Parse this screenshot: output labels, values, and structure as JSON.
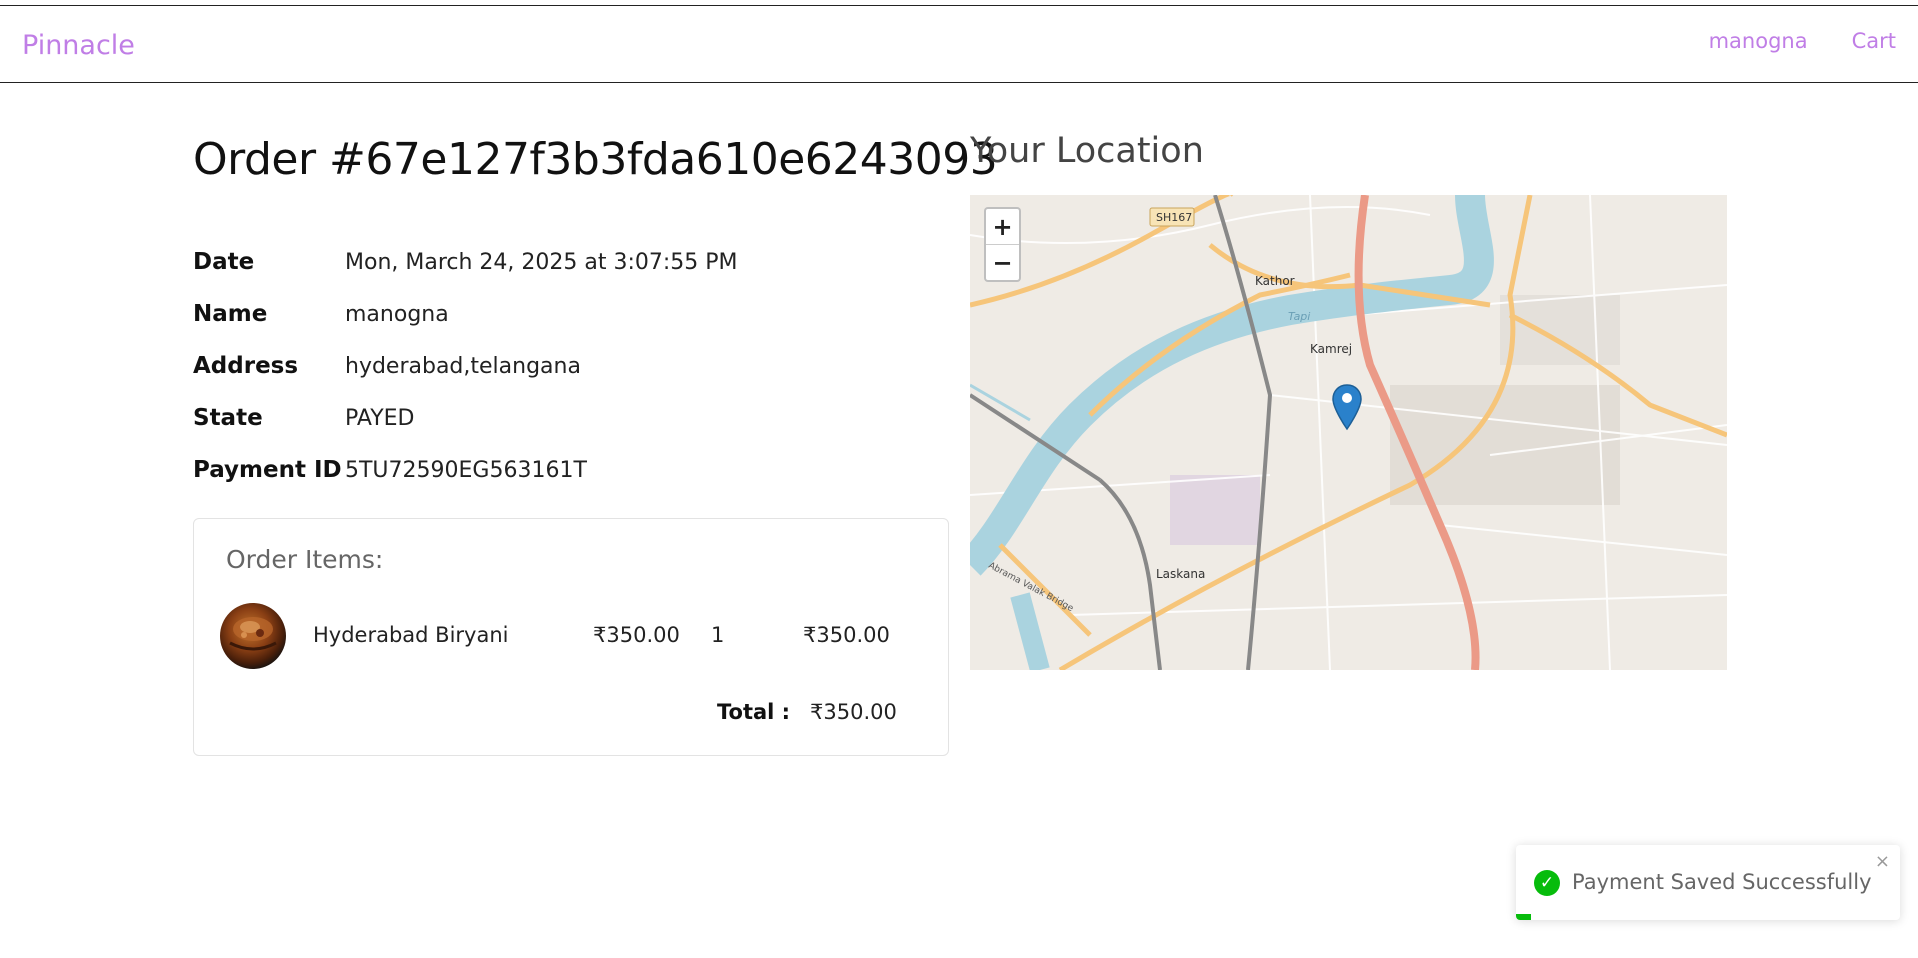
{
  "header": {
    "brand": "Pinnacle",
    "nav": [
      {
        "label": "manogna"
      },
      {
        "label": "Cart"
      }
    ]
  },
  "order": {
    "title": "Order #67e127f3b3fda610e6243093",
    "fields": [
      {
        "label": "Date",
        "value": "Mon, March 24, 2025 at 3:07:55 PM"
      },
      {
        "label": "Name",
        "value": "manogna"
      },
      {
        "label": "Address",
        "value": "hyderabad,telangana"
      },
      {
        "label": "State",
        "value": "PAYED"
      },
      {
        "label": "Payment ID",
        "value": "5TU72590EG563161T"
      }
    ],
    "items_title": "Order Items:",
    "items": [
      {
        "name": "Hyderabad Biryani",
        "price": "₹350.00",
        "quantity": "1",
        "total": "₹350.00"
      }
    ],
    "total_label": "Total :",
    "total_value": "₹350.00"
  },
  "location": {
    "title": "Your Location",
    "zoom_in": "+",
    "zoom_out": "−",
    "map_labels": [
      "SH167",
      "Kathor",
      "Tapi",
      "Kamrej",
      "Laskana",
      "Abrama Valak Bridge"
    ]
  },
  "toast": {
    "message": "Payment Saved Successfully",
    "close": "×",
    "check": "✓",
    "progress_fraction": 0.04
  },
  "colors": {
    "brand": "#c07ee6",
    "success": "#07bc0c",
    "river": "#aad3df",
    "road": "#f6c57a",
    "highway": "#eb9a87",
    "marker": "#2a81cb"
  }
}
